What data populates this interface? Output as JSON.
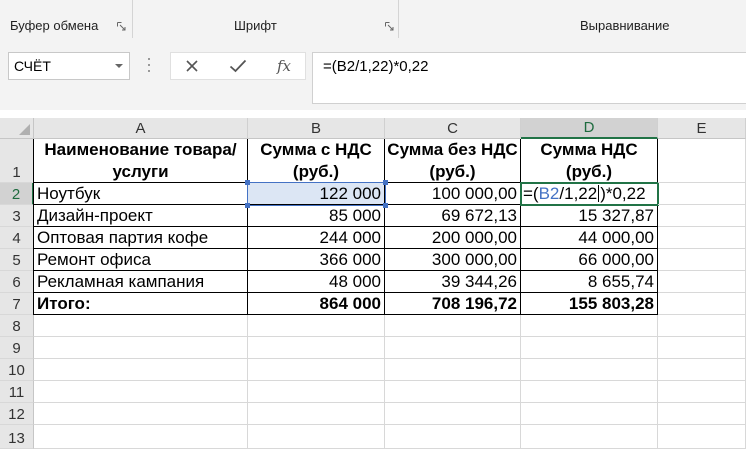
{
  "ribbon": {
    "clipboard_label": "Буфер обмена",
    "font_label": "Шрифт",
    "alignment_label": "Выравнивание"
  },
  "formula_bar": {
    "name_box": "СЧЁТ",
    "cancel_icon": "x-icon",
    "enter_icon": "check-icon",
    "fx_label": "fx",
    "formula": "=(B2/1,22)*0,22"
  },
  "sheet": {
    "columns": [
      "A",
      "B",
      "C",
      "D",
      "E"
    ],
    "selected_column": "D",
    "rows": [
      "1",
      "2",
      "3",
      "4",
      "5",
      "6",
      "7",
      "8",
      "9",
      "10",
      "11",
      "12",
      "13"
    ],
    "selected_row": "2",
    "headers": [
      "Наименование товара/услуги",
      "Сумма с НДС (руб.)",
      "Сумма без НДС (руб.)",
      "Сумма НДС (руб.)"
    ],
    "data": [
      {
        "name": "Ноутбук",
        "with_vat": "122 000",
        "without_vat": "100 000,00"
      },
      {
        "name": "Дизайн-проект",
        "with_vat": "85 000",
        "without_vat": "69 672,13",
        "vat": "15 327,87"
      },
      {
        "name": "Оптовая партия кофе",
        "with_vat": "244 000",
        "without_vat": "200 000,00",
        "vat": "44 000,00"
      },
      {
        "name": "Ремонт офиса",
        "with_vat": "366 000",
        "without_vat": "300 000,00",
        "vat": "66 000,00"
      },
      {
        "name": "Рекламная кампания",
        "with_vat": "48 000",
        "without_vat": "39 344,26",
        "vat": "8 655,74"
      }
    ],
    "total": {
      "label": "Итого:",
      "with_vat": "864 000",
      "without_vat": "708 196,72",
      "vat": "155 803,28"
    },
    "editing_cell": {
      "prefix": "=(",
      "ref": "B2",
      "middle": "/1,22",
      "suffix": ")*0,22"
    }
  },
  "colors": {
    "accent_green": "#217346",
    "reference_blue": "#4472c4",
    "selected_fill": "#dce6f4"
  }
}
